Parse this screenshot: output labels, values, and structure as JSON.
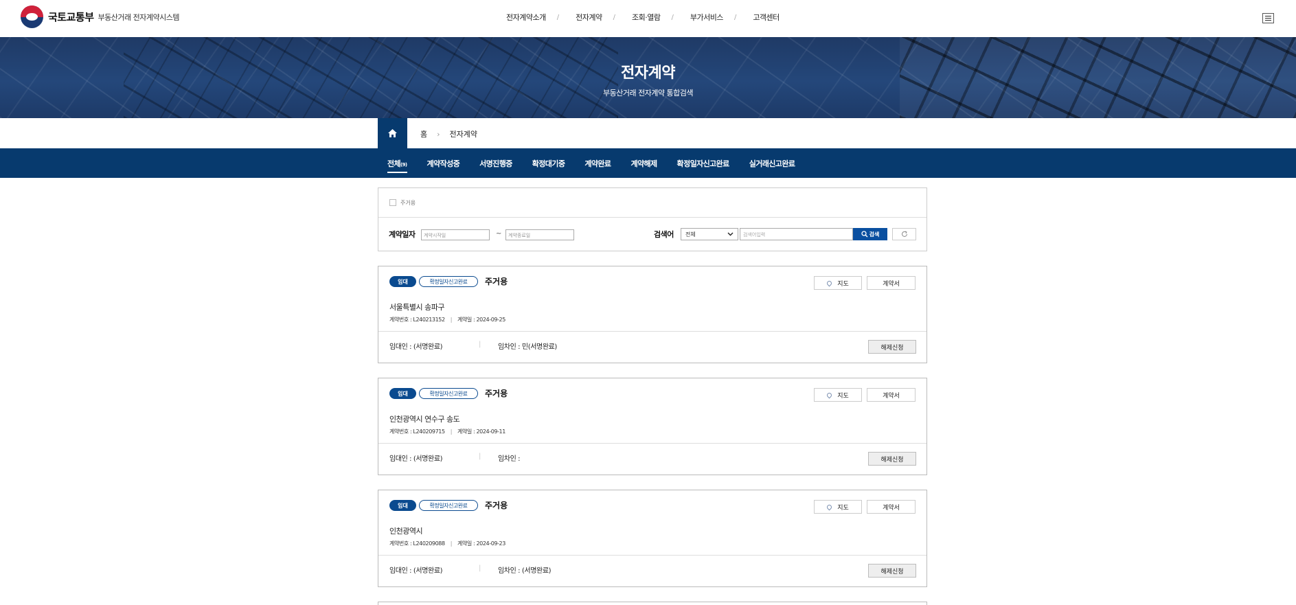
{
  "header": {
    "logo_main": "국토교통부",
    "logo_sub": "부동산거래 전자계약시스템",
    "nav": [
      "전자계약소개",
      "전자계약",
      "조회·열람",
      "부가서비스",
      "고객센터"
    ],
    "separator": "/"
  },
  "hero": {
    "title": "전자계약",
    "subtitle": "부동산거래 전자계약 통합검색"
  },
  "breadcrumb": {
    "home": "홈",
    "current": "전자계약",
    "chevron": "›"
  },
  "tabs": [
    {
      "label": "전체",
      "count": "(9)",
      "active": true
    },
    {
      "label": "계약작성중"
    },
    {
      "label": "서명진행중"
    },
    {
      "label": "확정대기중"
    },
    {
      "label": "계약완료"
    },
    {
      "label": "계약해제"
    },
    {
      "label": "확정일자신고완료"
    },
    {
      "label": "실거래신고완료"
    }
  ],
  "search": {
    "checkbox_label": "주거용",
    "date_label": "계약일자",
    "start_placeholder": "계약시작일",
    "tilde": "~",
    "end_placeholder": "계약종료일",
    "keyword_label": "검색어",
    "select_value": "전체",
    "keyword_placeholder": "검색어입력",
    "search_button": "검색"
  },
  "cards": [
    {
      "badge_type": "임대",
      "badge_status": "확정일자신고완료",
      "ctype": "주거용",
      "map_button": "지도",
      "doc_button": "계약서",
      "address": "서울특별시 송파구 ",
      "contract_no": "계약번호 : L240213152",
      "contract_date": "계약일 : 2024-09-25",
      "lessor": "임대인 : (서명완료)",
      "lessee": "임차인 : 민(서명완료)",
      "cancel_button": "해제신청"
    },
    {
      "badge_type": "임대",
      "badge_status": "확정일자신고완료",
      "ctype": "주거용",
      "map_button": "지도",
      "doc_button": "계약서",
      "address": "인천광역시 연수구 송도",
      "contract_no": "계약번호 : L240209715",
      "contract_date": "계약일 : 2024-09-11",
      "lessor": "임대인 : (서명완료)",
      "lessee": "임차인 : ",
      "cancel_button": "해제신청"
    },
    {
      "badge_type": "임대",
      "badge_status": "확정일자신고완료",
      "ctype": "주거용",
      "map_button": "지도",
      "doc_button": "계약서",
      "address": "인천광역시 ",
      "contract_no": "계약번호 : L240209088",
      "contract_date": "계약일 : 2024-09-23",
      "lessor": "임대인 : (서명완료)",
      "lessee": "임차인 : (서명완료)",
      "cancel_button": "해제신청"
    }
  ],
  "meta_separator": "|",
  "party_separator": "|"
}
